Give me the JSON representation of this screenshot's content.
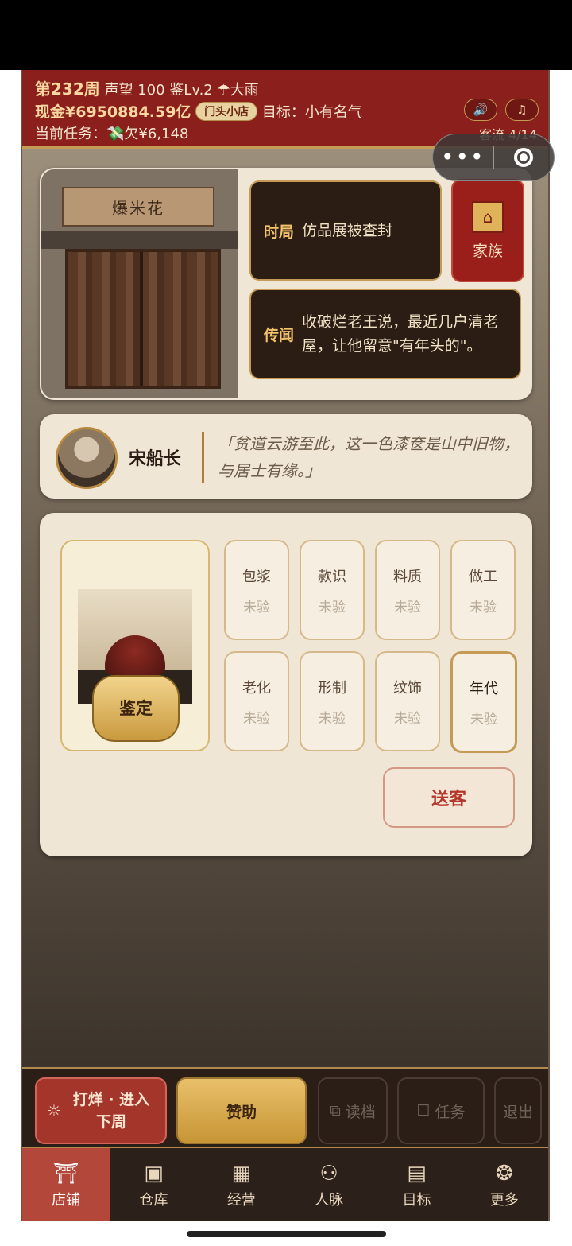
{
  "header": {
    "week": "第232周",
    "reputation": "声望 100",
    "appraisal_level": "鉴Lv.2",
    "weather": "大雨",
    "cash": "现金¥6950884.59亿",
    "shop_tag": "门头小店",
    "goal": "目标：小有名气",
    "task": "当前任务：💸欠¥6,148",
    "customer_flow": "客流 4/14"
  },
  "shop": {
    "sign": "爆米花",
    "era_label": "时局",
    "era_text": "仿品展被查封",
    "family_label": "家族",
    "rumor_label": "传闻",
    "rumor_text": "收破烂老王说，最近几户清老屋，让他留意\"有年头的\"。"
  },
  "speech": {
    "npc_name": "宋船长",
    "quote": "「贫道云游至此，这一色漆奁是山中旧物，与居士有缘。」"
  },
  "appraise": {
    "button": "鉴定",
    "tiles": [
      {
        "name": "包浆",
        "status": "未验"
      },
      {
        "name": "款识",
        "status": "未验"
      },
      {
        "name": "料质",
        "status": "未验"
      },
      {
        "name": "做工",
        "status": "未验"
      },
      {
        "name": "老化",
        "status": "未验"
      },
      {
        "name": "形制",
        "status": "未验"
      },
      {
        "name": "纹饰",
        "status": "未验"
      },
      {
        "name": "年代",
        "status": "未验"
      }
    ],
    "send_button": "送客"
  },
  "actions": {
    "close_shop": "打烊 · 进入下周",
    "sponsor": "赞助",
    "load": "读档",
    "tasks": "任务",
    "exit": "退出"
  },
  "tabs": [
    {
      "label": "店铺",
      "icon": "shop-icon"
    },
    {
      "label": "仓库",
      "icon": "warehouse-icon"
    },
    {
      "label": "经营",
      "icon": "abacus-icon"
    },
    {
      "label": "人脉",
      "icon": "people-icon"
    },
    {
      "label": "目标",
      "icon": "scroll-icon"
    },
    {
      "label": "更多",
      "icon": "more-icon"
    }
  ],
  "colors": {
    "header_red": "#8a1f1b",
    "gold": "#c49a55",
    "active_tab": "#b3473a"
  }
}
